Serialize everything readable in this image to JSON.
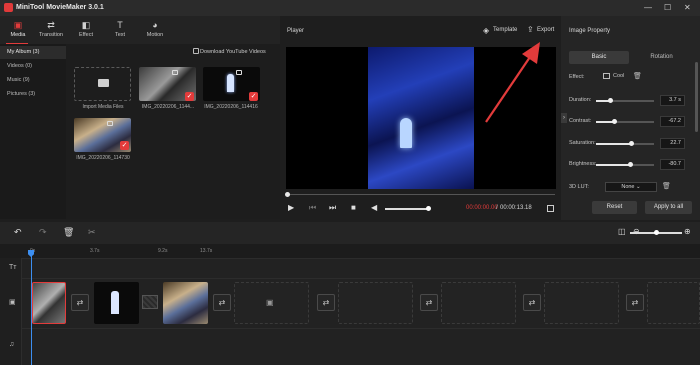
{
  "app": {
    "title": "MiniTool MovieMaker 3.0.1"
  },
  "window": {
    "minimize": "—",
    "maximize": "☐",
    "close": "✕"
  },
  "toolbar": {
    "items": [
      {
        "label": "Media",
        "icon": "film-icon",
        "glyph": "▣"
      },
      {
        "label": "Transition",
        "icon": "transition-icon",
        "glyph": "⇄"
      },
      {
        "label": "Effect",
        "icon": "effect-icon",
        "glyph": "◧"
      },
      {
        "label": "Text",
        "icon": "text-icon",
        "glyph": "T"
      },
      {
        "label": "Motion",
        "icon": "motion-icon",
        "glyph": "◕"
      }
    ]
  },
  "albums": [
    {
      "label": "My Album  (3)"
    },
    {
      "label": "Videos  (0)"
    },
    {
      "label": "Music  (9)"
    },
    {
      "label": "Pictures  (3)"
    }
  ],
  "media": {
    "download_youtube": "Download YouTube Videos",
    "import_label": "Import Media Files",
    "items": [
      {
        "name": "IMG_20220206_1144..."
      },
      {
        "name": "IMG_20220206_114416"
      },
      {
        "name": "IMG_20220206_114730"
      }
    ]
  },
  "player": {
    "label": "Player",
    "template": "Template",
    "export": "Export",
    "time_current": "00:00:00.00",
    "time_sep": "/",
    "time_total": "00:00:13.18",
    "progress": 0,
    "volume": 0.9
  },
  "property": {
    "title": "Image Property",
    "tabs": {
      "basic": "Basic",
      "rotation": "Rotation"
    },
    "effect_label": "Effect:",
    "effect_value": "Cool",
    "sliders": [
      {
        "label": "Duration:",
        "value": "3.7 s",
        "level": 0.25
      },
      {
        "label": "Contrast:",
        "value": "-67.2",
        "level": 0.32
      },
      {
        "label": "Saturation:",
        "value": "22.7",
        "level": 0.61
      },
      {
        "label": "Brightness:",
        "value": "-80.7",
        "level": 0.6
      }
    ],
    "lut_label": "3D LUT:",
    "lut_value": "None",
    "reset": "Reset",
    "apply_all": "Apply to all"
  },
  "timeline": {
    "ticks": [
      "0s",
      "3.7s",
      "9.2s",
      "13.7s"
    ],
    "zoom_level": 0.45
  },
  "colors": {
    "accent": "#e23b3b",
    "playhead": "#3c8ef0"
  }
}
